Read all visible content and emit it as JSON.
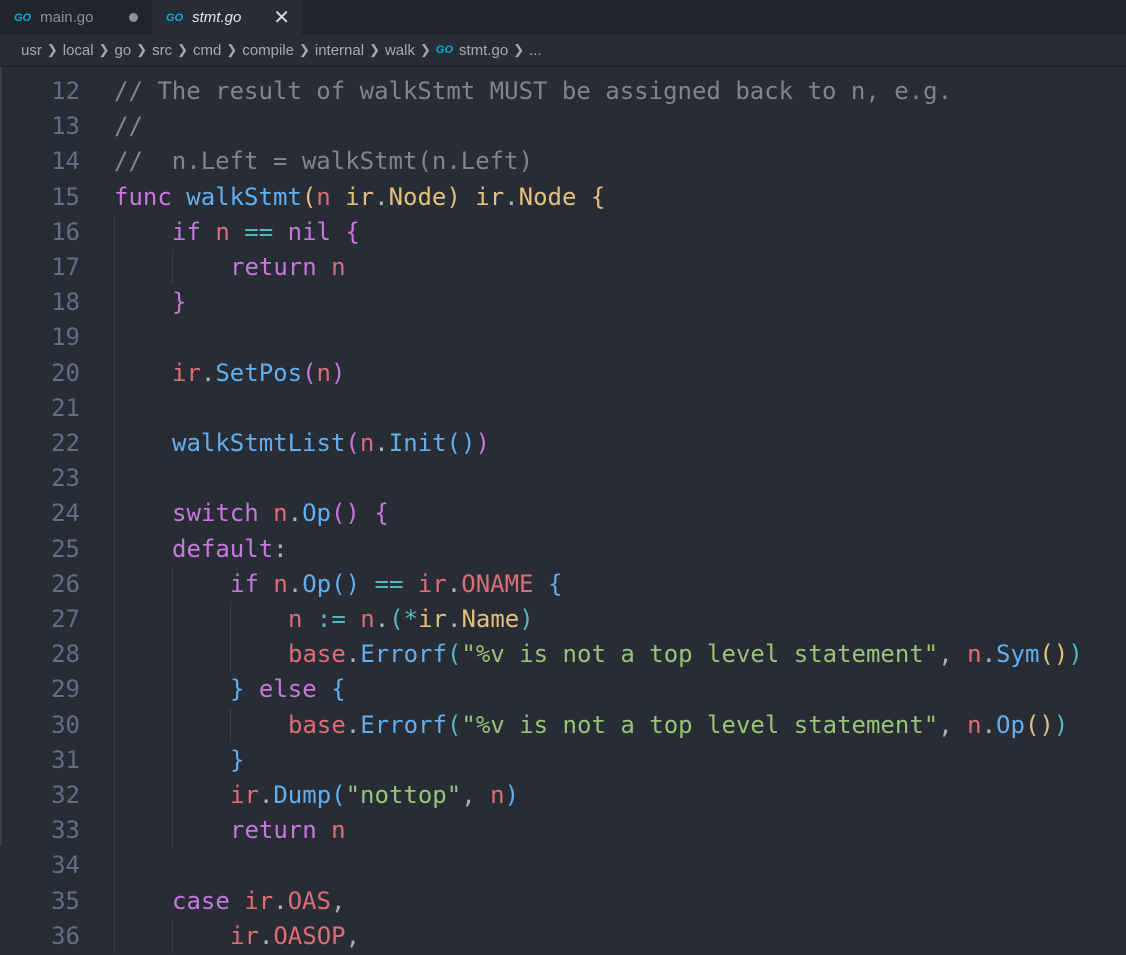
{
  "tabs": [
    {
      "label": "main.go",
      "icon": "go-file-icon",
      "icon_text": "GO",
      "dirty": true,
      "active": false
    },
    {
      "label": "stmt.go",
      "icon": "go-file-icon",
      "icon_text": "GO",
      "close": "✕",
      "active": true
    }
  ],
  "breadcrumb": {
    "segments": [
      "usr",
      "local",
      "go",
      "src",
      "cmd",
      "compile",
      "internal",
      "walk"
    ],
    "file": "stmt.go",
    "file_icon_text": "GO",
    "ellipsis": "..."
  },
  "colors": {
    "background": "#272c35",
    "tabbar": "#21252b",
    "comment": "#7f848e",
    "keyword": "#c678dd",
    "function": "#61afef",
    "variable": "#e06c75",
    "type": "#e5c07b",
    "string": "#98c379",
    "operator": "#56b6c2"
  },
  "code_lines": [
    {
      "num": "12",
      "indent": 0,
      "tokens": [
        [
          "cm",
          "// The result of walkStmt MUST be assigned back to n, e.g."
        ]
      ]
    },
    {
      "num": "13",
      "indent": 0,
      "tokens": [
        [
          "cm",
          "//"
        ]
      ]
    },
    {
      "num": "14",
      "indent": 0,
      "tokens": [
        [
          "cm",
          "//  n.Left = walkStmt(n.Left)"
        ]
      ]
    },
    {
      "num": "15",
      "indent": 0,
      "tokens": [
        [
          "kw",
          "func "
        ],
        [
          "fn",
          "walkStmt"
        ],
        [
          "b1",
          "("
        ],
        [
          "va",
          "n "
        ],
        [
          "ty",
          "ir"
        ],
        [
          "pu",
          "."
        ],
        [
          "ty",
          "Node"
        ],
        [
          "b1",
          ")"
        ],
        [
          "pu",
          " "
        ],
        [
          "ty",
          "ir"
        ],
        [
          "pu",
          "."
        ],
        [
          "ty",
          "Node"
        ],
        [
          "pu",
          " "
        ],
        [
          "b1",
          "{"
        ]
      ]
    },
    {
      "num": "16",
      "indent": 1,
      "tokens": [
        [
          "kw",
          "if "
        ],
        [
          "va",
          "n "
        ],
        [
          "op",
          "== "
        ],
        [
          "kw",
          "nil "
        ],
        [
          "b2",
          "{"
        ]
      ]
    },
    {
      "num": "17",
      "indent": 2,
      "tokens": [
        [
          "kw",
          "return "
        ],
        [
          "va",
          "n"
        ]
      ]
    },
    {
      "num": "18",
      "indent": 1,
      "tokens": [
        [
          "b2",
          "}"
        ]
      ]
    },
    {
      "num": "19",
      "indent": 0,
      "tokens": []
    },
    {
      "num": "20",
      "indent": 1,
      "tokens": [
        [
          "va",
          "ir"
        ],
        [
          "pu",
          "."
        ],
        [
          "fn",
          "SetPos"
        ],
        [
          "b2",
          "("
        ],
        [
          "va",
          "n"
        ],
        [
          "b2",
          ")"
        ]
      ]
    },
    {
      "num": "21",
      "indent": 0,
      "tokens": []
    },
    {
      "num": "22",
      "indent": 1,
      "tokens": [
        [
          "fn",
          "walkStmtList"
        ],
        [
          "b2",
          "("
        ],
        [
          "va",
          "n"
        ],
        [
          "pu",
          "."
        ],
        [
          "fn",
          "Init"
        ],
        [
          "b3",
          "()"
        ],
        [
          "b2",
          ")"
        ]
      ]
    },
    {
      "num": "23",
      "indent": 0,
      "tokens": []
    },
    {
      "num": "24",
      "indent": 1,
      "tokens": [
        [
          "kw",
          "switch "
        ],
        [
          "va",
          "n"
        ],
        [
          "pu",
          "."
        ],
        [
          "fn",
          "Op"
        ],
        [
          "b2",
          "()"
        ],
        [
          "pu",
          " "
        ],
        [
          "b2",
          "{"
        ]
      ]
    },
    {
      "num": "25",
      "indent": 1,
      "tokens": [
        [
          "kw",
          "default"
        ],
        [
          "pu",
          ":"
        ]
      ]
    },
    {
      "num": "26",
      "indent": 2,
      "tokens": [
        [
          "kw",
          "if "
        ],
        [
          "va",
          "n"
        ],
        [
          "pu",
          "."
        ],
        [
          "fn",
          "Op"
        ],
        [
          "b3",
          "()"
        ],
        [
          "pu",
          " "
        ],
        [
          "op",
          "== "
        ],
        [
          "va",
          "ir"
        ],
        [
          "pu",
          "."
        ],
        [
          "va",
          "ONAME "
        ],
        [
          "b3",
          "{"
        ]
      ]
    },
    {
      "num": "27",
      "indent": 3,
      "tokens": [
        [
          "va",
          "n "
        ],
        [
          "op",
          ":= "
        ],
        [
          "va",
          "n"
        ],
        [
          "pu",
          "."
        ],
        [
          "b4",
          "("
        ],
        [
          "op",
          "*"
        ],
        [
          "ty",
          "ir"
        ],
        [
          "pu",
          "."
        ],
        [
          "ty",
          "Name"
        ],
        [
          "b4",
          ")"
        ]
      ]
    },
    {
      "num": "28",
      "indent": 3,
      "tokens": [
        [
          "va",
          "base"
        ],
        [
          "pu",
          "."
        ],
        [
          "fn",
          "Errorf"
        ],
        [
          "b4",
          "("
        ],
        [
          "st",
          "\"%v is not a top level statement\""
        ],
        [
          "pu",
          ", "
        ],
        [
          "va",
          "n"
        ],
        [
          "pu",
          "."
        ],
        [
          "fn",
          "Sym"
        ],
        [
          "b1",
          "()"
        ],
        [
          "b4",
          ")"
        ]
      ]
    },
    {
      "num": "29",
      "indent": 2,
      "tokens": [
        [
          "b3",
          "}"
        ],
        [
          "pu",
          " "
        ],
        [
          "kw",
          "else "
        ],
        [
          "b3",
          "{"
        ]
      ]
    },
    {
      "num": "30",
      "indent": 3,
      "tokens": [
        [
          "va",
          "base"
        ],
        [
          "pu",
          "."
        ],
        [
          "fn",
          "Errorf"
        ],
        [
          "b4",
          "("
        ],
        [
          "st",
          "\"%v is not a top level statement\""
        ],
        [
          "pu",
          ", "
        ],
        [
          "va",
          "n"
        ],
        [
          "pu",
          "."
        ],
        [
          "fn",
          "Op"
        ],
        [
          "b1",
          "()"
        ],
        [
          "b4",
          ")"
        ]
      ]
    },
    {
      "num": "31",
      "indent": 2,
      "tokens": [
        [
          "b3",
          "}"
        ]
      ]
    },
    {
      "num": "32",
      "indent": 2,
      "tokens": [
        [
          "va",
          "ir"
        ],
        [
          "pu",
          "."
        ],
        [
          "fn",
          "Dump"
        ],
        [
          "b3",
          "("
        ],
        [
          "st",
          "\"nottop\""
        ],
        [
          "pu",
          ", "
        ],
        [
          "va",
          "n"
        ],
        [
          "b3",
          ")"
        ]
      ]
    },
    {
      "num": "33",
      "indent": 2,
      "tokens": [
        [
          "kw",
          "return "
        ],
        [
          "va",
          "n"
        ]
      ]
    },
    {
      "num": "34",
      "indent": 0,
      "tokens": []
    },
    {
      "num": "35",
      "indent": 1,
      "tokens": [
        [
          "kw",
          "case "
        ],
        [
          "va",
          "ir"
        ],
        [
          "pu",
          "."
        ],
        [
          "va",
          "OAS"
        ],
        [
          "pu",
          ","
        ]
      ]
    },
    {
      "num": "36",
      "indent": 2,
      "tokens": [
        [
          "va",
          "ir"
        ],
        [
          "pu",
          "."
        ],
        [
          "va",
          "OASOP"
        ],
        [
          "pu",
          ","
        ]
      ]
    }
  ]
}
